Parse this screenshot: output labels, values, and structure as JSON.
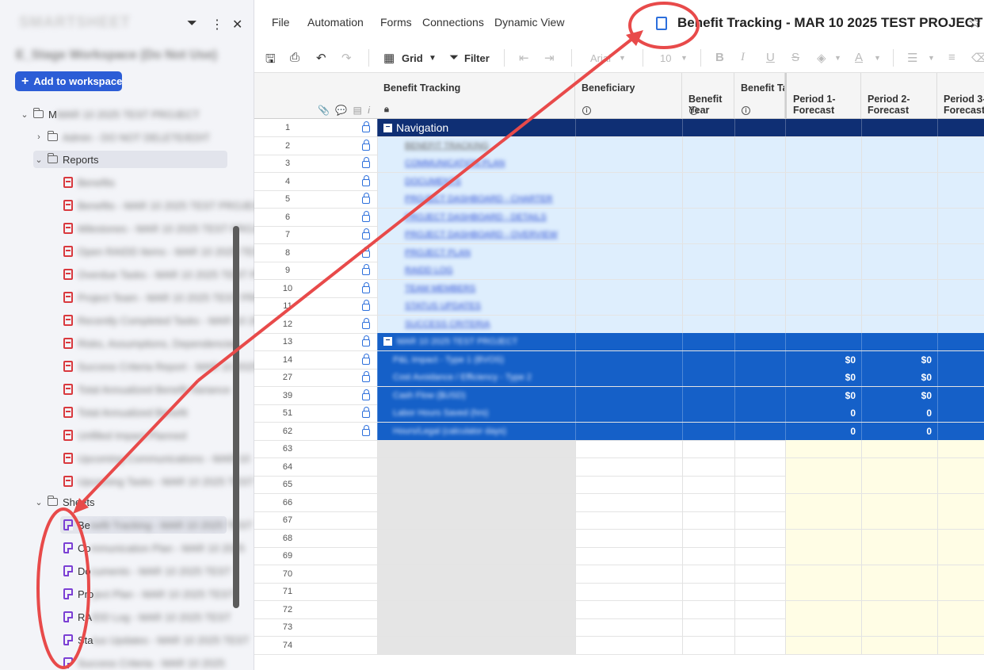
{
  "sidebar": {
    "logo": "SMARTSHEET",
    "workspace_name": "E_Stage Workspace (Do Not Use)",
    "add_button_label": "Add to workspace",
    "project_folder": "MAR 10 2025 TEST PROJECT",
    "admin_folder": "Admin - DO NOT DELETE/EDIT",
    "reports_folder": "Reports",
    "reports": [
      "Benefits",
      "Benefits - MAR 10 2025 TEST PROJECT",
      "Milestones - MAR 10 2025 TEST PROJECT",
      "Open RAIDD Items - MAR 10 2025 TEST PROJECT",
      "Overdue Tasks - MAR 10 2025 TEST PROJECT",
      "Project Team - MAR 10 2025 TEST PROJECT",
      "Recently Completed Tasks - MAR 10 2025",
      "Risks, Assumptions, Dependencies",
      "Success Criteria Report - MAR 10 2025",
      "Total Annualized Benefit Variance",
      "Total Annualized Benefit",
      "Unfilled Impact Planned",
      "Upcoming Communications - MAR 10",
      "Upcoming Tasks - MAR 10 2025 TEST"
    ],
    "sheets_folder": "Sheets",
    "sheets": [
      {
        "prefix": "Be",
        "rest": "nefit Tracking - MAR 10 2025 TEST"
      },
      {
        "prefix": "Co",
        "rest": "mmunication Plan - MAR 10 2025"
      },
      {
        "prefix": "Do",
        "rest": "cuments - MAR 10 2025 TEST"
      },
      {
        "prefix": "Pro",
        "rest": "ject Plan - MAR 10 2025 TEST"
      },
      {
        "prefix": "RA",
        "rest": "IDD Log - MAR 10 2025 TEST"
      },
      {
        "prefix": "Sta",
        "rest": "tus Updates - MAR 10 2025 TEST"
      },
      {
        "prefix": "",
        "rest": "Success Criteria - MAR 10 2025"
      }
    ]
  },
  "menu": {
    "items": [
      "File",
      "Automation",
      "Forms",
      "Connections",
      "Dynamic View"
    ],
    "title": "Benefit Tracking - MAR 10 2025 TEST PROJECT"
  },
  "toolbar": {
    "grid_label": "Grid",
    "filter_label": "Filter",
    "font_label": "Arial",
    "size_label": "10"
  },
  "columns": [
    {
      "label": "Benefit Tracking",
      "sub": "lock"
    },
    {
      "label": "Beneficiary",
      "sub": "info"
    },
    {
      "label": "Benefit\nYear",
      "sub": "info"
    },
    {
      "label": "Benefit Ta",
      "sub": "info"
    },
    {
      "label": "Period 1-\nForecast",
      "sub": ""
    },
    {
      "label": "Period 2-\nForecast",
      "sub": ""
    },
    {
      "label": "Period 3-\nForecast",
      "sub": ""
    }
  ],
  "navigation_label": "Navigation",
  "nav_links": [
    "BENEFIT TRACKING",
    "COMMUNICATION PLAN",
    "DOCUMENTS",
    "PROJECT DASHBOARD - CHARTER",
    "PROJECT DASHBOARD - DETAILS",
    "PROJECT DASHBOARD - OVERVIEW",
    "PROJECT PLAN",
    "RAIDD LOG",
    "TEAM MEMBERS",
    "STATUS UPDATES",
    "SUCCESS CRITERIA"
  ],
  "project_row_label": "MAR 10 2025 TEST PROJECT",
  "summary_rows": [
    {
      "num": "14",
      "label": "P&L Impact - Type 1 (BVOS)",
      "p1": "$0",
      "p2": "$0"
    },
    {
      "num": "27",
      "label": "Cost Avoidance / Efficiency - Type 2",
      "p1": "$0",
      "p2": "$0"
    },
    {
      "num": "39",
      "label": "Cash Flow ($USD)",
      "p1": "$0",
      "p2": "$0"
    },
    {
      "num": "51",
      "label": "Labor Hours Saved (hrs)",
      "p1": "0",
      "p2": "0"
    },
    {
      "num": "62",
      "label": "Hours/Legal (calculator days)",
      "p1": "0",
      "p2": "0"
    }
  ],
  "row_numbers_top": [
    "1",
    "2",
    "3",
    "4",
    "5",
    "6",
    "7",
    "8",
    "9",
    "10",
    "11",
    "12",
    "13"
  ],
  "row_numbers_bottom": [
    "63",
    "64",
    "65",
    "66",
    "67",
    "68",
    "69",
    "70",
    "71",
    "72",
    "73",
    "74"
  ],
  "colors": {
    "accent": "#2c5dd6",
    "nav_header": "#0f2f74",
    "nav_rows": "#deeefd",
    "summary_rows": "#1560c8",
    "annotation": "#e84a4a",
    "forecast_bg": "#fffde5"
  }
}
